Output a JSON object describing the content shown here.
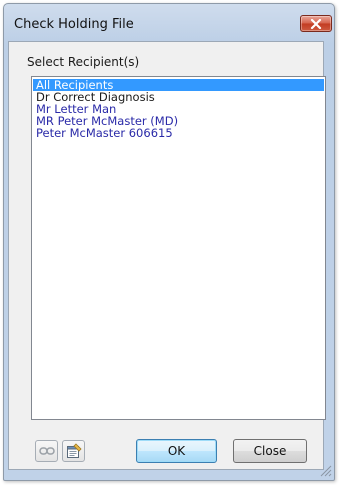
{
  "window": {
    "title": "Check Holding File"
  },
  "recipients": {
    "label": "Select Recipient(s)",
    "items": [
      {
        "text": "All Recipients",
        "state": "selected"
      },
      {
        "text": "Dr Correct Diagnosis",
        "state": "dark"
      },
      {
        "text": "Mr Letter Man",
        "state": "blue"
      },
      {
        "text": "MR Peter McMaster (MD)",
        "state": "blue"
      },
      {
        "text": "Peter McMaster 606615",
        "state": "blue"
      }
    ]
  },
  "toolbar": {
    "link_icon": "link-icon",
    "properties_icon": "properties-icon"
  },
  "buttons": {
    "ok": "OK",
    "close": "Close"
  },
  "colors": {
    "selection": "#3399ff",
    "item_blue": "#2a2aa8",
    "close_button": "#c94a30"
  }
}
